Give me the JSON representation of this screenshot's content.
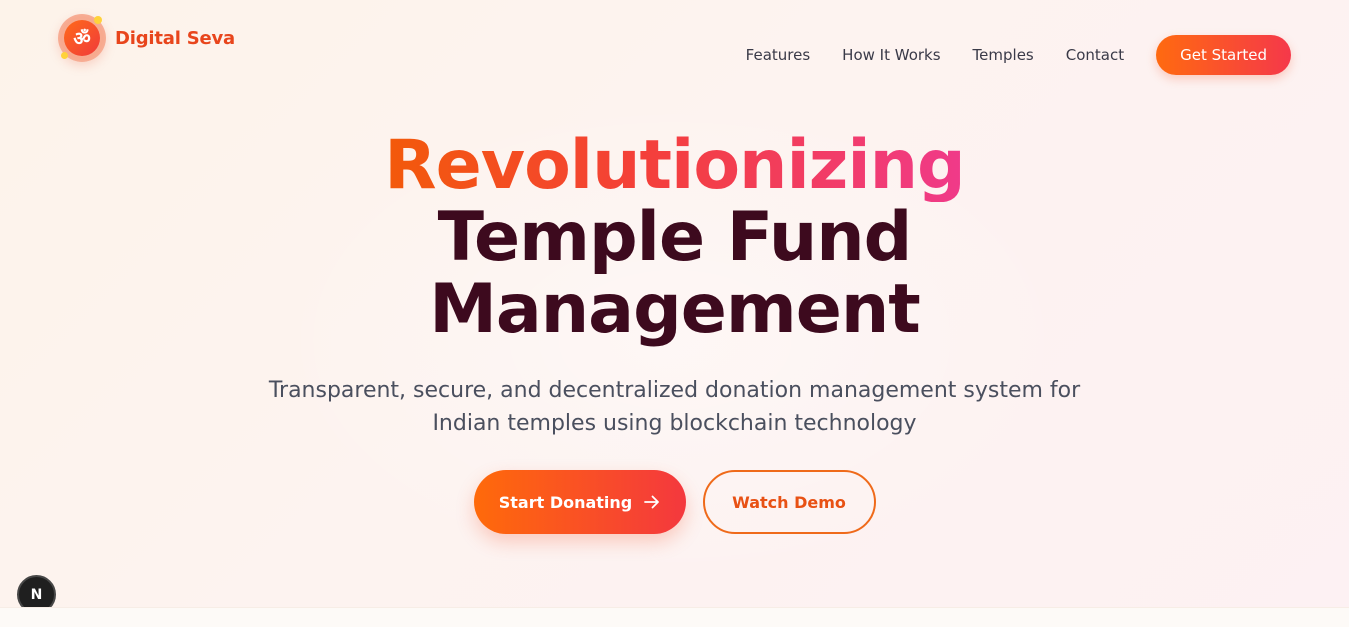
{
  "header": {
    "logo_glyph": "ॐ",
    "brand_name": "Digital Seva",
    "nav": [
      {
        "label": "Features"
      },
      {
        "label": "How It Works"
      },
      {
        "label": "Temples"
      },
      {
        "label": "Contact"
      }
    ],
    "cta_label": "Get Started"
  },
  "hero": {
    "headline_gradient": "Revolutionizing",
    "headline_line2": "Temple Fund",
    "headline_line3": "Management",
    "subtitle": "Transparent, secure, and decentralized donation management system for Indian temples using blockchain technology",
    "primary_button": "Start Donating",
    "primary_button_icon": "arrow-right-icon",
    "secondary_button": "Watch Demo"
  },
  "dev_badge": {
    "label": "N"
  },
  "colors": {
    "accent_orange": "#ff6a10",
    "accent_red": "#f5384a",
    "accent_pink": "#f03a8a",
    "headline_dark": "#3d0a1e"
  }
}
